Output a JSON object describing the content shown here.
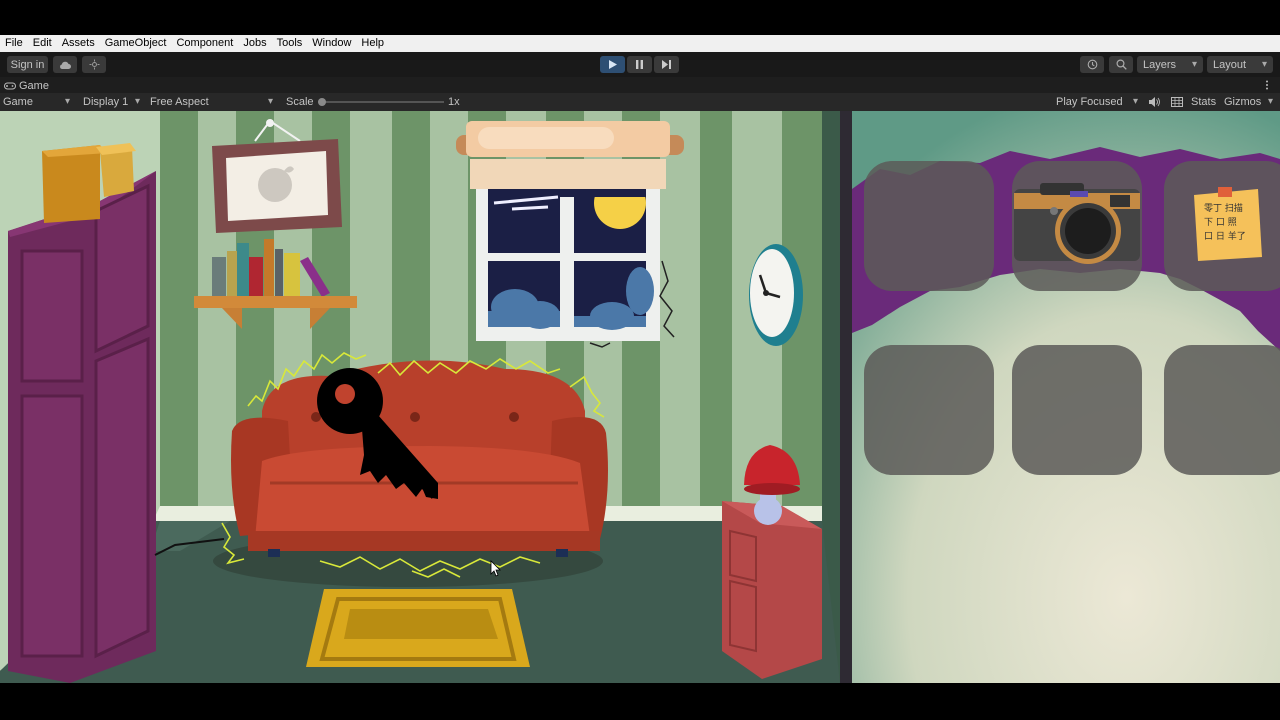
{
  "menu": [
    "File",
    "Edit",
    "Assets",
    "GameObject",
    "Component",
    "Jobs",
    "Tools",
    "Window",
    "Help"
  ],
  "toolbar": {
    "sign_in": "Sign in",
    "layers": "Layers",
    "layout": "Layout"
  },
  "tab": {
    "label": "Game"
  },
  "gamebar": {
    "mode": "Game",
    "display": "Display 1",
    "aspect": "Free Aspect",
    "scale_label": "Scale",
    "scale_value": "1x",
    "play_focused": "Play Focused",
    "stats": "Stats",
    "gizmos": "Gizmos"
  },
  "note": {
    "lines": [
      "零丁 扫描",
      "下 口 照",
      "口 日 羊了"
    ]
  },
  "colors": {
    "accent": "#2e4f73",
    "wall_light": "#a9c2a4",
    "wall_stripe": "#6f946a",
    "floor": "#3f5b50",
    "sofa": "#c0432e",
    "wardrobe": "#6e2a5c",
    "rug": "#d9a81c",
    "inventory_bg": "#dfe3cf",
    "inventory_purple": "#6a2a7a"
  },
  "icons": [
    "play-icon",
    "pause-icon",
    "step-icon",
    "cloud-icon",
    "collab-icon",
    "history-icon",
    "search-icon",
    "menu-dots-icon",
    "gamepad-icon",
    "audio-icon",
    "stats-grid-icon"
  ]
}
